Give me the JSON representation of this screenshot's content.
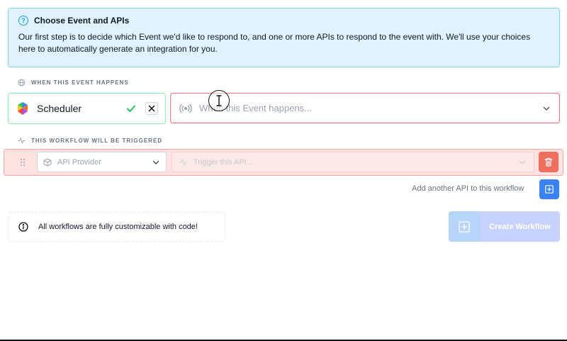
{
  "banner": {
    "title": "Choose Event and APIs",
    "text": "Our first step is to decide which Event we'd like to respond to, and one or more APIs to respond to the event with. We'll use your choices here to automatically generate an integration for you."
  },
  "event_section": {
    "label": "WHEN THIS EVENT HAPPENS",
    "selected_source": "Scheduler",
    "event_placeholder": "When this Event happens..."
  },
  "trigger_section": {
    "label": "THIS WORKFLOW WILL BE TRIGGERED",
    "api_provider_placeholder": "API Provider",
    "trigger_placeholder": "Trigger this API..."
  },
  "add_api": {
    "label": "Add another API to this workflow"
  },
  "customize": {
    "text": "All workflows are fully customizable with code!"
  },
  "create": {
    "label": "Create Workflow"
  },
  "colors": {
    "banner_bg": "#e0f2fe",
    "success": "#22c55e",
    "error": "#f87171",
    "delete": "#ef6f5e",
    "primary": "#3b82f6"
  }
}
